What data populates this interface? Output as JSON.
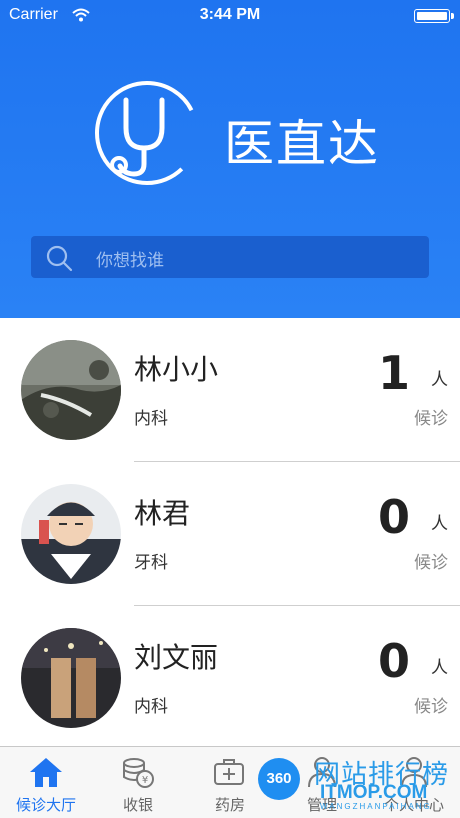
{
  "status_bar": {
    "carrier": "Carrier",
    "time": "3:44 PM"
  },
  "header": {
    "brand": "医直达",
    "logo_icon": "stethoscope-icon",
    "color": "#1f74f0"
  },
  "search": {
    "placeholder": "你想找谁",
    "icon": "search-icon"
  },
  "doctors": [
    {
      "name": "林小小",
      "dept": "内科",
      "count": "1",
      "unit": "人",
      "status": "候诊"
    },
    {
      "name": "林君",
      "dept": "牙科",
      "count": "0",
      "unit": "人",
      "status": "候诊"
    },
    {
      "name": "刘文丽",
      "dept": "内科",
      "count": "0",
      "unit": "人",
      "status": "候诊"
    }
  ],
  "tabs": [
    {
      "label": "候诊大厅",
      "icon": "home-icon",
      "active": true
    },
    {
      "label": "收银",
      "icon": "coins-icon",
      "active": false
    },
    {
      "label": "药房",
      "icon": "medicine-kit-icon",
      "active": false
    },
    {
      "label": "管理",
      "icon": "doctor-icon",
      "active": false
    },
    {
      "label": "个人中心",
      "icon": "person-icon",
      "active": false
    }
  ],
  "watermark": {
    "badge": "360",
    "text": "网站排行榜",
    "domain": "ITMOP.COM",
    "sub": "WANGZHANPAIHANG"
  }
}
